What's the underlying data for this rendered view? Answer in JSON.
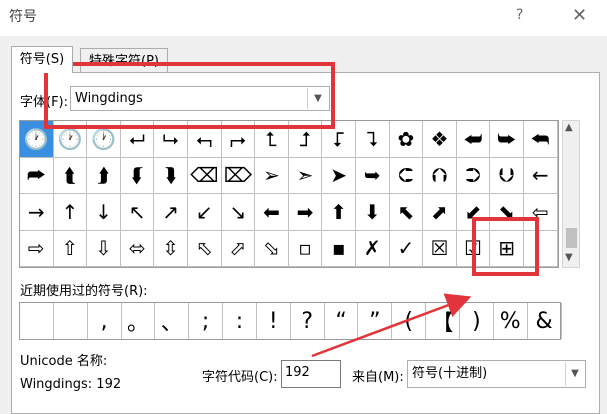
{
  "window": {
    "title": "符号",
    "help": "?",
    "close": "✕"
  },
  "tabs": [
    {
      "label": "符号(S)"
    },
    {
      "label": "特殊字符(P)"
    }
  ],
  "font": {
    "label": "字体(F):",
    "value": "Wingdings"
  },
  "symbols": [
    [
      "🕐",
      "🕐",
      "🕐",
      "⮠",
      "⮡",
      "⮢",
      "⮣",
      "⮤",
      "⮥",
      "⮦",
      "⮧",
      "✿",
      "❖",
      "⮨",
      "⮩",
      "⮪"
    ],
    [
      "⮫",
      "⮬",
      "⮭",
      "⮮",
      "⮯",
      "⌫",
      "⌦",
      "➢",
      "➣",
      "➤",
      "➥",
      "⮈",
      "⮉",
      "⮊",
      "⮋",
      "←"
    ],
    [
      "→",
      "↑",
      "↓",
      "↖",
      "↗",
      "↙",
      "↘",
      "⬅",
      "➡",
      "⬆",
      "⬇",
      "⬉",
      "⬈",
      "⬋",
      "⬊",
      "⇦"
    ],
    [
      "⇨",
      "⇧",
      "⇩",
      "⬄",
      "⇳",
      "⬁",
      "⬀",
      "⬂",
      "▫",
      "▪",
      "✗",
      "✓",
      "☒",
      "☑",
      "⊞",
      ""
    ]
  ],
  "selected_symbol_index": 0,
  "recent": {
    "label": "近期使用过的符号(R):",
    "symbols": [
      "",
      "",
      ",",
      "。",
      "、",
      ";",
      ":",
      "!",
      "?",
      "“",
      "”",
      "(",
      "【",
      ")",
      "%",
      "&"
    ]
  },
  "unicode": {
    "name_label": "Unicode 名称:",
    "name_value": "Wingdings: 192"
  },
  "char_code": {
    "label": "字符代码(C):",
    "value": "192"
  },
  "from": {
    "label": "来自(M):",
    "value": "符号(十进制)"
  },
  "colors": {
    "annotation": "#e2343b",
    "selection": "#3a8fe0"
  }
}
